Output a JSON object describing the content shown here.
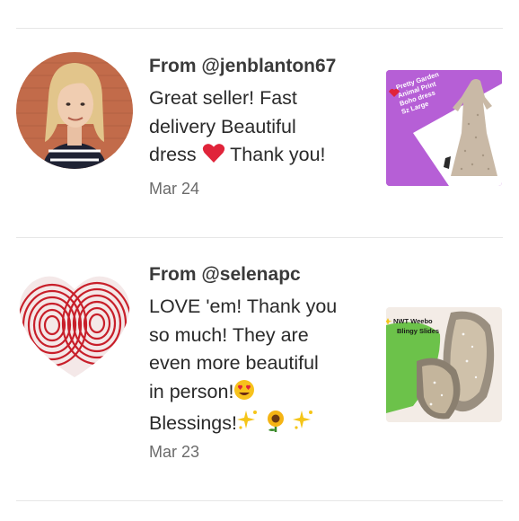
{
  "reviews": [
    {
      "from": "From @jenblanton67",
      "text": "Great seller! Fast delivery Beautiful dress ❤️ Thank you!",
      "text_line1": "Great seller! Fast",
      "text_line2": "delivery Beautiful",
      "text_line3_a": "dress ",
      "text_line3_emoji": "❤️",
      "text_line3_b": " Thank you!",
      "date": "Mar 24",
      "thumb_caption": [
        "Pretty Garden",
        "Animal Print",
        "Boho dress",
        "Sz Large"
      ],
      "thumb_bg": "#b65fd6"
    },
    {
      "from": "From @selenapc",
      "text": "LOVE 'em! Thank you so much! They are even more beautiful in person!😍 Blessings!✨🌻✨",
      "text_line1": "LOVE 'em! Thank you",
      "text_line2": "so much! They are",
      "text_line3": "even more beautiful",
      "text_line4_a": "in person!",
      "text_line4_emoji": "😍",
      "text_line5_a": "Blessings!",
      "text_line5_emoji": "✨🌻✨",
      "date": "Mar 23",
      "thumb_caption": [
        "NWT Weebo",
        "Blingy Slides"
      ],
      "thumb_bg": "#f3ece6",
      "thumb_accent": "#6cc24a"
    }
  ]
}
